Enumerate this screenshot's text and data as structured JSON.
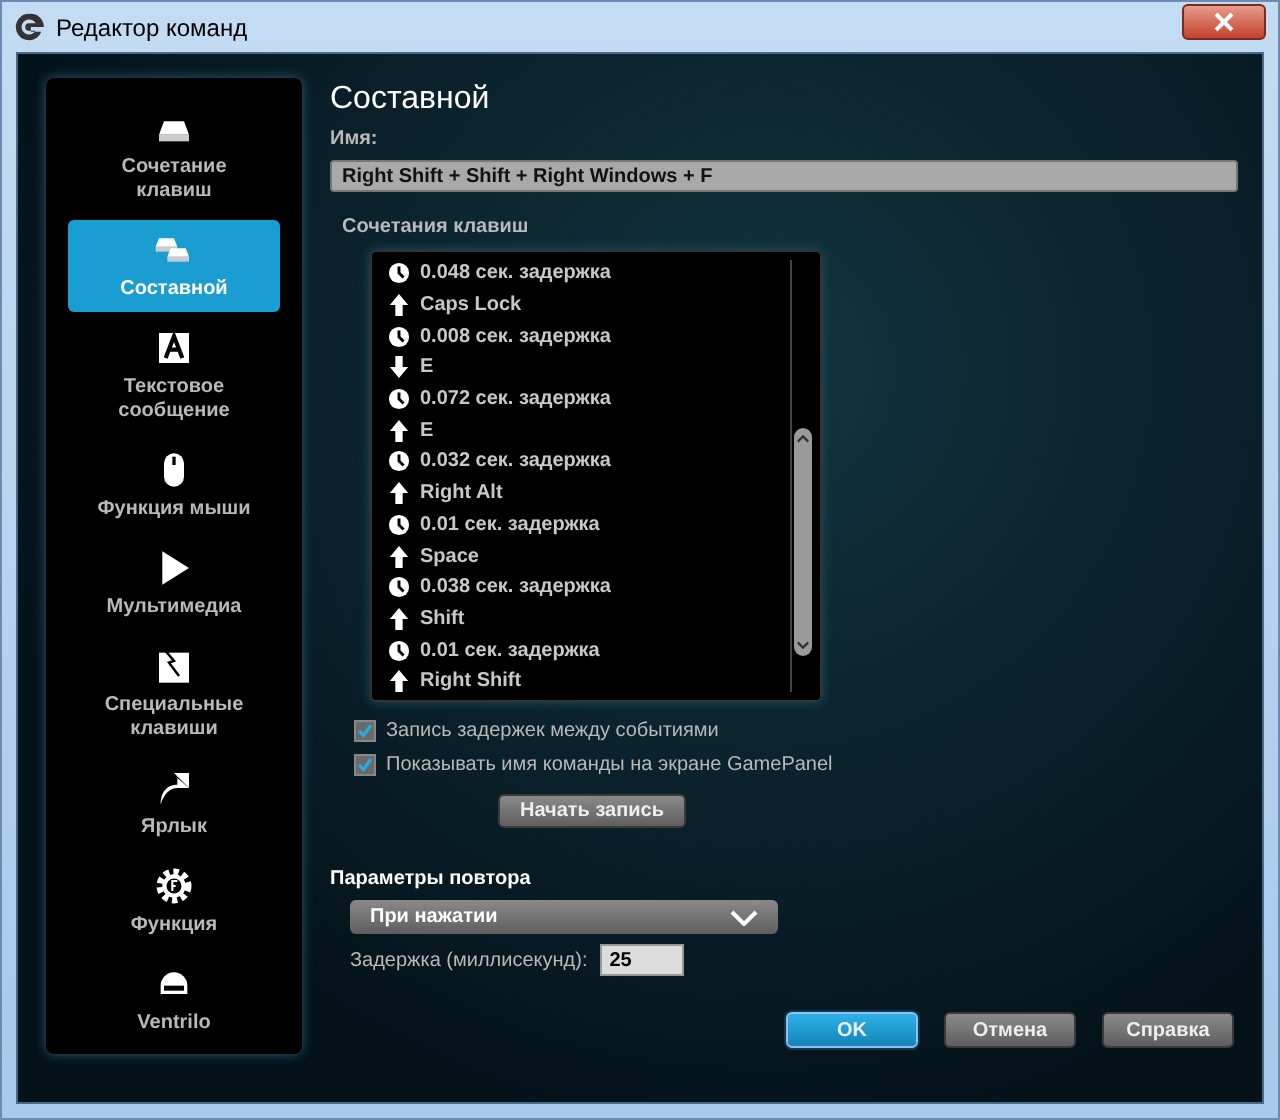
{
  "window": {
    "title": "Редактор команд"
  },
  "sidebar": {
    "items": [
      {
        "kind": "keystroke",
        "label": "Сочетание клавиш",
        "selected": false
      },
      {
        "kind": "multikey",
        "label": "Составной",
        "selected": true
      },
      {
        "kind": "text",
        "label": "Текстовое сообщение",
        "selected": false
      },
      {
        "kind": "mouse",
        "label": "Функция мыши",
        "selected": false
      },
      {
        "kind": "media",
        "label": "Мультимедиа",
        "selected": false
      },
      {
        "kind": "hotkey",
        "label": "Специальные клавиши",
        "selected": false
      },
      {
        "kind": "shortcut",
        "label": "Ярлык",
        "selected": false
      },
      {
        "kind": "function",
        "label": "Функция",
        "selected": false
      },
      {
        "kind": "ventrilo",
        "label": "Ventrilo",
        "selected": false
      }
    ]
  },
  "heading": "Составной",
  "name_field": {
    "label": "Имя:",
    "value": "Right Shift + Shift + Right Windows + F"
  },
  "keystrokes": {
    "label": "Сочетания клавиш",
    "events": [
      {
        "kind": "delay",
        "text": "0.048 сек. задержка"
      },
      {
        "kind": "up",
        "text": "Caps Lock"
      },
      {
        "kind": "delay",
        "text": "0.008 сек. задержка"
      },
      {
        "kind": "down",
        "text": "E"
      },
      {
        "kind": "delay",
        "text": "0.072 сек. задержка"
      },
      {
        "kind": "up",
        "text": "E"
      },
      {
        "kind": "delay",
        "text": "0.032 сек. задержка"
      },
      {
        "kind": "up",
        "text": "Right Alt"
      },
      {
        "kind": "delay",
        "text": "0.01 сек. задержка"
      },
      {
        "kind": "up",
        "text": "Space"
      },
      {
        "kind": "delay",
        "text": "0.038 сек. задержка"
      },
      {
        "kind": "up",
        "text": "Shift"
      },
      {
        "kind": "delay",
        "text": "0.01 сек. задержка"
      },
      {
        "kind": "up",
        "text": "Right Shift"
      }
    ]
  },
  "options": [
    {
      "label": "Запись задержек между событиями",
      "checked": true
    },
    {
      "label": "Показывать имя команды на экране GamePanel",
      "checked": true
    }
  ],
  "record_button": "Начать запись",
  "repeat": {
    "title": "Параметры повтора",
    "mode": "При нажатии",
    "delay_label": "Задержка (миллисекунд):",
    "delay_value": "25"
  },
  "buttons": [
    {
      "label": "OK",
      "kind": "primary"
    },
    {
      "label": "Отмена",
      "kind": "normal"
    },
    {
      "label": "Справка",
      "kind": "normal"
    }
  ]
}
